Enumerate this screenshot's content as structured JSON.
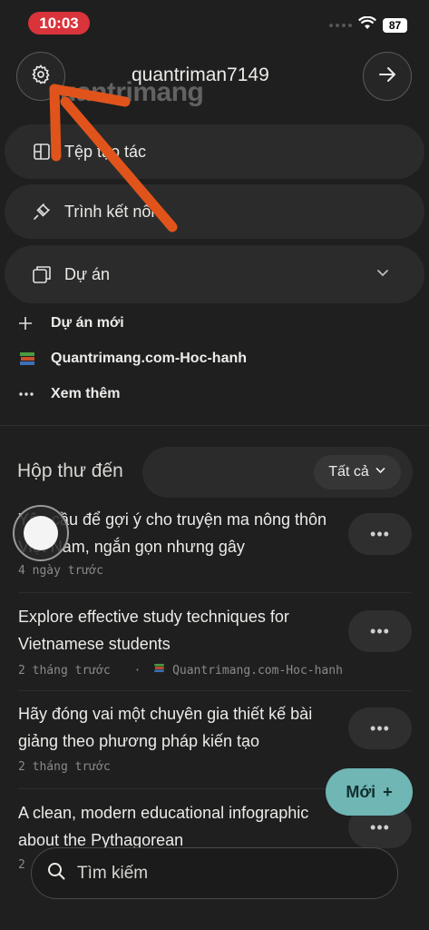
{
  "status_bar": {
    "time": "10:03",
    "battery": "87"
  },
  "header": {
    "username": "quantriman7149",
    "watermark": "uantrimang"
  },
  "nav": {
    "artifacts": "Tệp tạo tác",
    "connectors": "Trình kết nối",
    "projects": "Dự án"
  },
  "projects": {
    "new_project": "Dự án mới",
    "project_1": "Quantrimang.com-Hoc-hanh",
    "see_more": "Xem thêm"
  },
  "inbox": {
    "title": "Hộp thư đến",
    "filter": "Tất cả",
    "items": [
      {
        "title": "Yêu cầu để gợi ý cho truyện ma nông thôn Việt Nam, ngắn gọn nhưng gây",
        "meta": "4 ngày trước",
        "project": ""
      },
      {
        "title": "Explore effective study techniques for Vietnamese students",
        "meta": "2 tháng trước",
        "project": "Quantrimang.com-Hoc-hanh"
      },
      {
        "title": "Hãy đóng vai một chuyên gia thiết kế bài giảng theo phương pháp kiến tạo",
        "meta": "2 tháng trước",
        "project": ""
      },
      {
        "title": "A clean, modern educational infographic about the Pythagorean",
        "meta": "2",
        "project": ""
      }
    ]
  },
  "new_button": {
    "label": "Mới",
    "icon": "+"
  },
  "search": {
    "label": "Tìm kiếm"
  },
  "colors": {
    "accent": "#6fb6b5",
    "status_pill": "#d9343b",
    "annotation": "#e0541c"
  }
}
